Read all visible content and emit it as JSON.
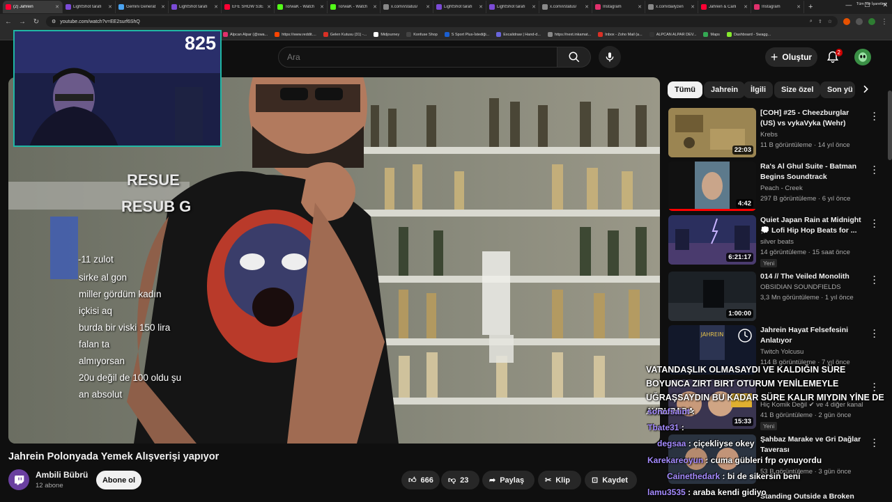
{
  "browser": {
    "tabs": [
      {
        "label": "(2) Jahrein",
        "color": "#ff0033",
        "active": true
      },
      {
        "label": "LightShot tarafı",
        "color": "#7b4bd6"
      },
      {
        "label": "Gemini Generat",
        "color": "#4aa3f0"
      },
      {
        "label": "LightShot tarafı",
        "color": "#7b4bd6"
      },
      {
        "label": "EFE SHOW S3E",
        "color": "#ff0033"
      },
      {
        "label": "TorwaK - Watch",
        "color": "#53fc18"
      },
      {
        "label": "TorwaK - Watch",
        "color": "#53fc18"
      },
      {
        "label": "x.com/i/status/",
        "color": "#888888"
      },
      {
        "label": "LightShot tarafı",
        "color": "#7b4bd6"
      },
      {
        "label": "LightShot tarafı",
        "color": "#7b4bd6"
      },
      {
        "label": "x.com/i/status/",
        "color": "#888888"
      },
      {
        "label": "Instagram",
        "color": "#e1306c"
      },
      {
        "label": "x.com/dailyzen",
        "color": "#888888"
      },
      {
        "label": "Jahrein & Carli",
        "color": "#ff0033"
      },
      {
        "label": "Instagram",
        "color": "#e1306c"
      }
    ],
    "url": "youtube.com/watch?v=EE2surf6ShQ",
    "bookmarks": [
      {
        "label": "Alpcan Alpar (@swa...",
        "color": "#e1306c"
      },
      {
        "label": "https://www.reddit....",
        "color": "#ff4500"
      },
      {
        "label": "Gelen Kutusu (31) -...",
        "color": "#d93025"
      },
      {
        "label": "Midjourney",
        "color": "#ffffff"
      },
      {
        "label": "Konfuse Shop",
        "color": "#444444"
      },
      {
        "label": "S Sport Plus-İstediği...",
        "color": "#1a5fd1"
      },
      {
        "label": "Excalidraw | Hand-d...",
        "color": "#6965db"
      },
      {
        "label": "https://next.inkamat...",
        "color": "#888888"
      },
      {
        "label": "Inbox - Zoho Mail (a...",
        "color": "#d93025"
      },
      {
        "label": "ALPCAN ALPAR DEV...",
        "color": "#333333"
      },
      {
        "label": "Maps",
        "color": "#34a853"
      },
      {
        "label": "Dashboard - Swagg...",
        "color": "#85ea2d"
      }
    ],
    "all_bookmarks": "Tüm Yer İşaretleri"
  },
  "header": {
    "search_placeholder": "Ara",
    "create_label": "Oluştur",
    "notifications_count": "2"
  },
  "player": {
    "viewer_count": "825",
    "overlay_texts": {
      "resub1": "RESUE",
      "resub2": "RESUB G",
      "chat": [
        "-11 zulot",
        "sirke al gon",
        "miller gördüm kadın",
        "içkisi aq",
        "burda bir viski 150 lira",
        "falan ta",
        "almıyorsan",
        "20u değil de 100 oldu şu",
        "an absolut"
      ]
    }
  },
  "video": {
    "title": "Jahrein Polonyada Yemek Alışverişi yapıyor",
    "channel": "Ambili Bübrü",
    "subscribers": "12 abone",
    "subscribe_label": "Abone ol",
    "likes": "666",
    "dislikes": "23",
    "share_label": "Paylaş",
    "clip_label": "Klip",
    "save_label": "Kaydet"
  },
  "chips": [
    "Tümü",
    "Jahrein",
    "İlgili",
    "Size özel",
    "Son yü"
  ],
  "recommendations": [
    {
      "title": "[COH] #25 - Cheezburglar (US) vs vykaVyka (Wehr)",
      "channel": "Krebs",
      "stats": "11 B görüntüleme · 14 yıl önce",
      "duration": "22:03"
    },
    {
      "title": "Ra's Al Ghul Suite - Batman Begins Soundtrack",
      "channel": "Peach - Creek",
      "stats": "297 B görüntüleme · 6 yıl önce",
      "duration": "4:42"
    },
    {
      "title": "Quiet Japan Rain at Midnight 💭 Lofi Hip Hop Beats for ...",
      "channel": "silver beats",
      "stats": "14 görüntüleme · 15 saat önce",
      "duration": "6:21:17",
      "badge": "Yeni"
    },
    {
      "title": "014 // The Veiled Monolith",
      "channel": "OBSIDIAN SOUNDFIELDS",
      "stats": "3,3 Mn görüntüleme · 1 yıl önce",
      "duration": "1:00:00"
    },
    {
      "title": "Jahrein Hayat Felsefesini Anlatıyor",
      "channel": "Twitch Yolcusu",
      "stats": "114 B görüntüleme · 7 yıl önce"
    },
    {
      "title": "",
      "channel": "Hiç Komik Değil ✔ ve 4 diğer kanal",
      "stats": "41 B görüntüleme · 2 gün önce",
      "duration": "15:33",
      "badge": "Yeni"
    },
    {
      "title": "Şahbaz Marake ve Gri Dağlar Taverası",
      "channel": "",
      "stats": "53 B görüntüleme · 3 gün önce"
    },
    {
      "title": "Standing Outside a Broken",
      "channel": "",
      "stats": ""
    }
  ],
  "stream_overlay": {
    "headline": "VATANDAŞLIK OLMASAYDI VE KALDIĞIN SÜRE BOYUNCA ZIRT BIRT OTURUM YENİLEMEYLE UĞRAŞSAYDIN BU KADAR SÜRE KALIR MIYDIN YİNE DE AVRUPADA",
    "messages": [
      {
        "name": "sonofsaint",
        "msg": ""
      },
      {
        "name": "Tbate31",
        "msg": ""
      },
      {
        "name": "degsaa",
        "msg": "çiçekliyse okey"
      },
      {
        "name": "Karekareoyun",
        "msg": "cuma gübleri frp oynuyordu"
      },
      {
        "name": "Cainethedark",
        "msg": "bi de sikersin beni"
      },
      {
        "name": "lamu3535",
        "msg": "araba kendi gidiyo"
      }
    ]
  }
}
